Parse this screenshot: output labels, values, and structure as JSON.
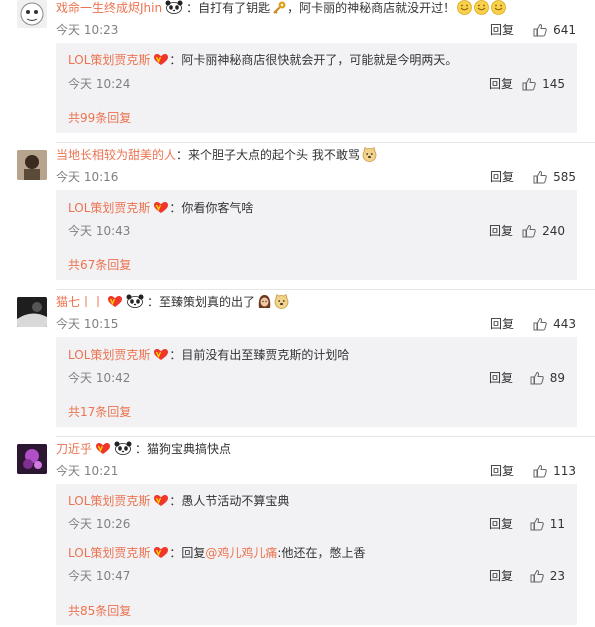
{
  "threads": [
    {
      "user": "戏命一生终成烬Jhin",
      "text": "：自打有了钥匙",
      "text2": "，阿卡丽的神秘商店就没开过！",
      "time": "今天 10:23",
      "reply_label": "回复",
      "likes": "641",
      "replies": [
        {
          "user": "LOL策划贾克斯",
          "text": "：阿卡丽神秘商店很快就会开了，可能就是今明两天。",
          "time": "今天 10:24",
          "reply_label": "回复",
          "likes": "145"
        }
      ],
      "more": "共99条回复"
    },
    {
      "user": "当地长相较为甜美的人",
      "text": "：来个胆子大点的起个头 我不敢骂",
      "time": "今天 10:16",
      "reply_label": "回复",
      "likes": "585",
      "replies": [
        {
          "user": "LOL策划贾克斯",
          "text": "：你看你客气啥",
          "time": "今天 10:43",
          "reply_label": "回复",
          "likes": "240"
        }
      ],
      "more": "共67条回复"
    },
    {
      "user": "猫七丨丨",
      "text": "：至臻策划真的出了",
      "time": "今天 10:15",
      "reply_label": "回复",
      "likes": "443",
      "replies": [
        {
          "user": "LOL策划贾克斯",
          "text": "：目前没有出至臻贾克斯的计划哈",
          "time": "今天 10:42",
          "reply_label": "回复",
          "likes": "89"
        }
      ],
      "more": "共17条回复"
    },
    {
      "user": "刀近乎",
      "text": "：猫狗宝典搞快点",
      "time": "今天 10:21",
      "reply_label": "回复",
      "likes": "113",
      "replies": [
        {
          "user": "LOL策划贾克斯",
          "text": "：愚人节活动不算宝典",
          "time": "今天 10:26",
          "reply_label": "回复",
          "likes": "11"
        },
        {
          "user": "LOL策划贾克斯",
          "text_prefix": "：回复",
          "mention": "@鸡儿鸡儿痛",
          "text": ":他还在，憋上香",
          "time": "今天 10:47",
          "reply_label": "回复",
          "likes": "23"
        }
      ],
      "more": "共85条回复"
    }
  ],
  "colors": {
    "username": "#eb7350",
    "reply_bg": "#f2f2f5",
    "meta": "#808080"
  }
}
